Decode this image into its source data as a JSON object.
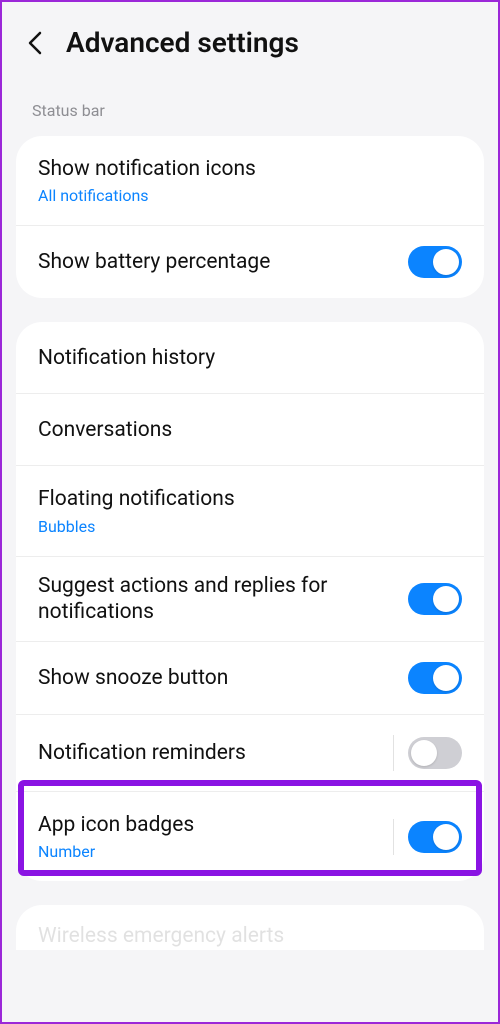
{
  "header": {
    "title": "Advanced settings"
  },
  "sections": {
    "statusBar": {
      "label": "Status bar",
      "items": {
        "showIcons": {
          "title": "Show notification icons",
          "sub": "All notifications"
        },
        "showBattery": {
          "title": "Show battery percentage",
          "toggle": true
        }
      }
    },
    "main": {
      "items": {
        "history": {
          "title": "Notification history"
        },
        "conversations": {
          "title": "Conversations"
        },
        "floating": {
          "title": "Floating notifications",
          "sub": "Bubbles"
        },
        "suggest": {
          "title": "Suggest actions and replies for notifications",
          "toggle": true
        },
        "snooze": {
          "title": "Show snooze button",
          "toggle": true
        },
        "reminders": {
          "title": "Notification reminders",
          "toggle": false
        },
        "badges": {
          "title": "App icon badges",
          "sub": "Number",
          "toggle": true
        }
      }
    },
    "cutoff": {
      "title": "Wireless emergency alerts"
    }
  }
}
